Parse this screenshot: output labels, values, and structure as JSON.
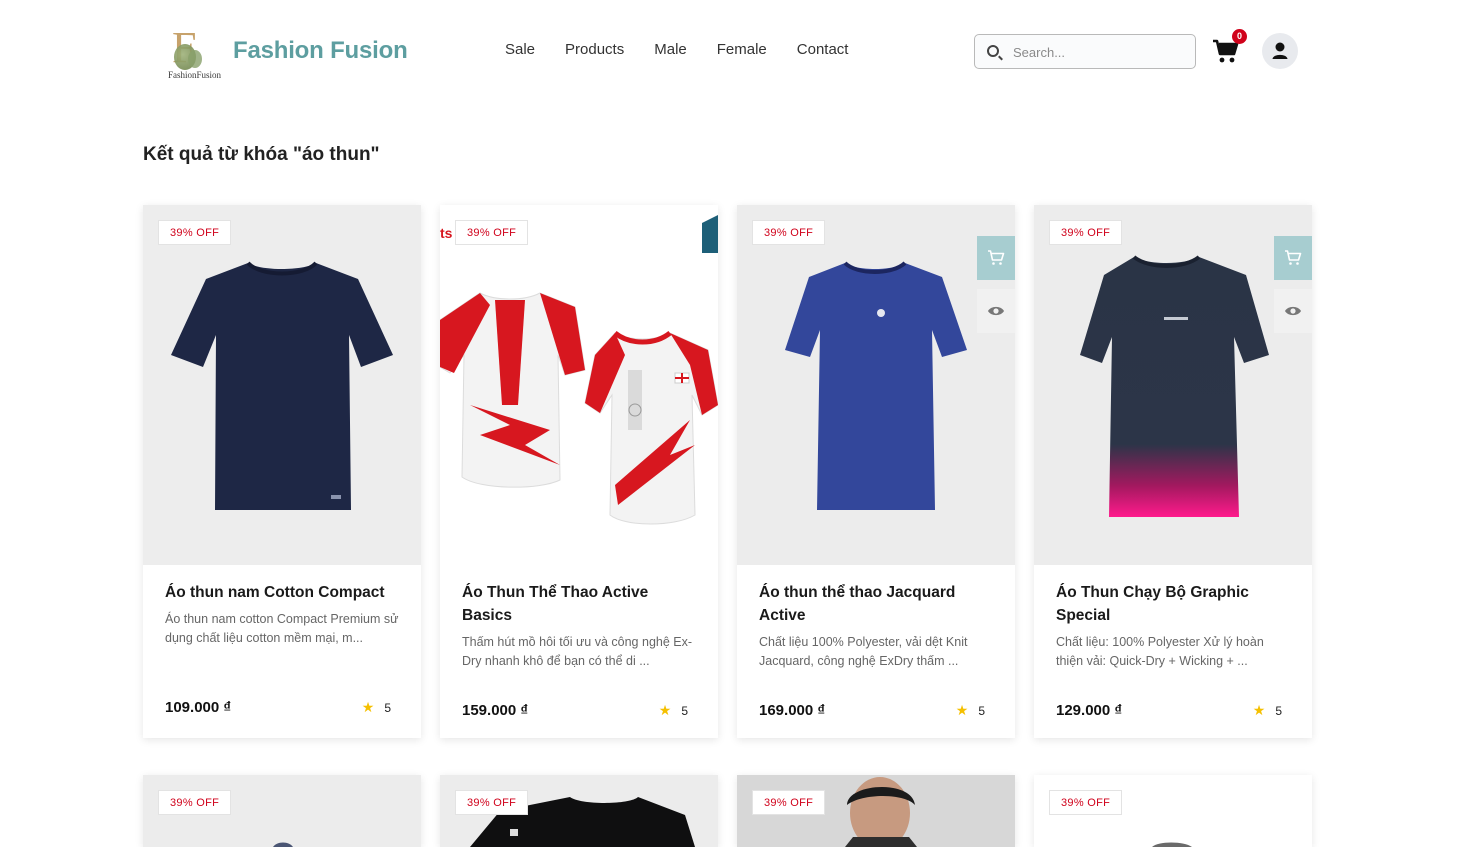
{
  "header": {
    "logo_mark": "F",
    "logo_text": "FashionFusion",
    "brand": "Fashion Fusion",
    "nav": [
      "Sale",
      "Products",
      "Male",
      "Female",
      "Contact"
    ],
    "search_placeholder": "Search...",
    "cart_count": "0",
    "icons": {
      "search": "search-icon",
      "cart": "cart-icon",
      "user": "user-icon"
    },
    "brand_color": "#5d9ea0",
    "badge_color": "#d0021b"
  },
  "results_title": "Kết quả từ khóa \"áo thun\"",
  "products": [
    {
      "discount": "39% OFF",
      "name": "Áo thun nam Cotton Compact",
      "desc": "Áo thun nam cotton Compact Premium sử dụng chất liệu cotton mềm mại, m...",
      "price": "109.000 ₫",
      "rating": "5"
    },
    {
      "discount": "39% OFF",
      "name": "Áo Thun Thể Thao Active Basics",
      "desc": "Thấm hút mồ hôi tối ưu và công nghệ Ex-Dry nhanh khô để bạn có thể di ...",
      "price": "159.000 ₫",
      "rating": "5"
    },
    {
      "discount": "39% OFF",
      "name": "Áo thun thể thao Jacquard Active",
      "desc": "Chất liệu 100% Polyester, vải dệt Knit Jacquard, công nghệ ExDry thấm ...",
      "price": "169.000 ₫",
      "rating": "5"
    },
    {
      "discount": "39% OFF",
      "name": "Áo Thun Chạy Bộ Graphic Special",
      "desc": "Chất liệu: 100% Polyester Xử lý hoàn thiện vải: Quick-Dry + Wicking + ...",
      "price": "129.000 ₫",
      "rating": "5"
    }
  ],
  "row2_discounts": [
    "39% OFF",
    "39% OFF",
    "39% OFF",
    "39% OFF"
  ]
}
